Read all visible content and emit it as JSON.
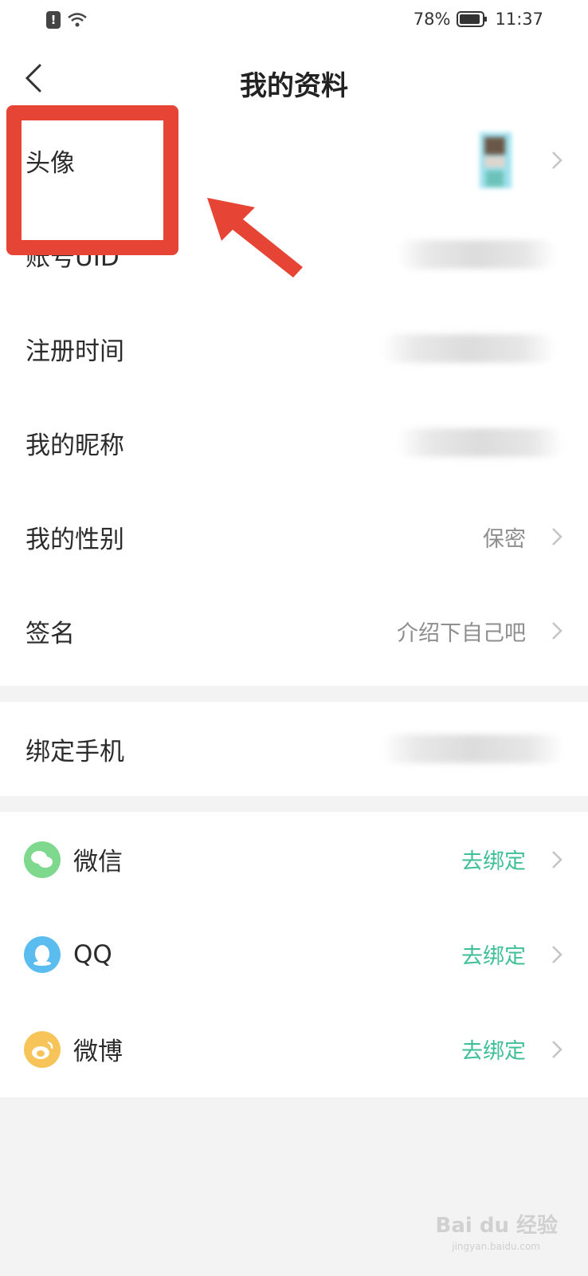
{
  "status_bar": {
    "alert_glyph": "!",
    "battery_percent": "78%",
    "time": "11:37"
  },
  "header": {
    "title": "我的资料",
    "back_icon": "chevron-left-icon"
  },
  "profile_rows": [
    {
      "label": "头像"
    },
    {
      "label": "账号UID"
    },
    {
      "label": "注册时间"
    },
    {
      "label": "我的昵称"
    },
    {
      "label": "我的性别",
      "value": "保密"
    },
    {
      "label": "签名",
      "value": "介绍下自己吧"
    }
  ],
  "phone_row": {
    "label": "绑定手机"
  },
  "social_rows": [
    {
      "label": "微信",
      "action": "去绑定",
      "icon": "wechat-icon"
    },
    {
      "label": "QQ",
      "action": "去绑定",
      "icon": "qq-icon"
    },
    {
      "label": "微博",
      "action": "去绑定",
      "icon": "weibo-icon"
    }
  ],
  "watermark": {
    "text": "Bai du 经验",
    "sub": "jingyan.baidu.com"
  },
  "colors": {
    "accent_link": "#3fbf96",
    "highlight": "#e64535",
    "background": "#f3f3f3"
  }
}
